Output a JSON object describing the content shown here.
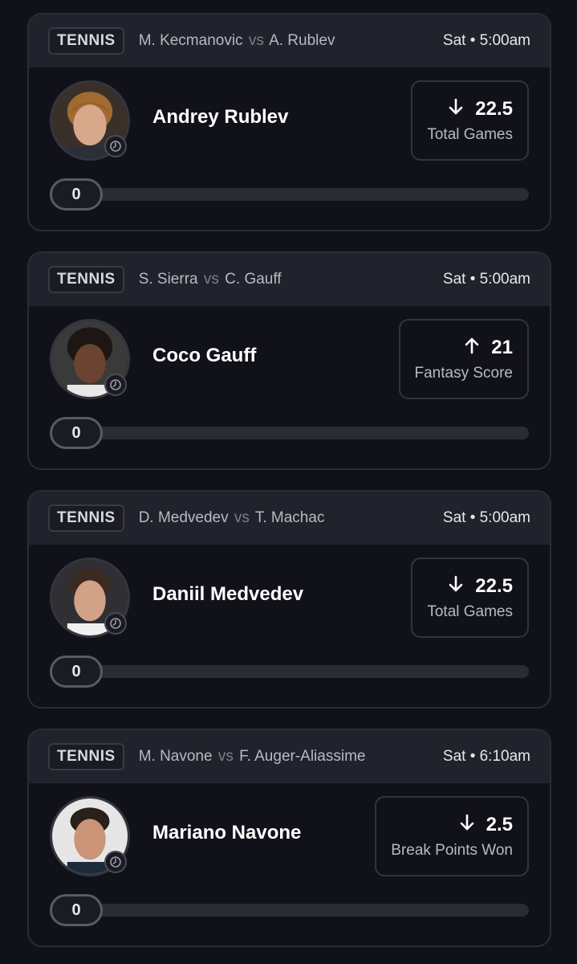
{
  "cards": [
    {
      "sport": "TENNIS",
      "home": "M. Kecmanovic",
      "vs": "vs",
      "away": "A. Rublev",
      "time": "Sat • 5:00am",
      "player": "Andrey Rublev",
      "direction": "down",
      "line": "22.5",
      "stat": "Total Games",
      "progress_value": "0",
      "progress_fraction": 0
    },
    {
      "sport": "TENNIS",
      "home": "S. Sierra",
      "vs": "vs",
      "away": "C. Gauff",
      "time": "Sat • 5:00am",
      "player": "Coco Gauff",
      "direction": "up",
      "line": "21",
      "stat": "Fantasy Score",
      "progress_value": "0",
      "progress_fraction": 0
    },
    {
      "sport": "TENNIS",
      "home": "D. Medvedev",
      "vs": "vs",
      "away": "T. Machac",
      "time": "Sat • 5:00am",
      "player": "Daniil Medvedev",
      "direction": "down",
      "line": "22.5",
      "stat": "Total Games",
      "progress_value": "0",
      "progress_fraction": 0
    },
    {
      "sport": "TENNIS",
      "home": "M. Navone",
      "vs": "vs",
      "away": "F. Auger-Aliassime",
      "time": "Sat • 6:10am",
      "player": "Mariano Navone",
      "direction": "down",
      "line": "2.5",
      "stat": "Break Points Won",
      "progress_value": "0",
      "progress_fraction": 0
    }
  ],
  "icons": {
    "arrow_down": "arrow-down-icon",
    "arrow_up": "arrow-up-icon",
    "clock": "clock-icon"
  },
  "colors": {
    "background": "#11111a",
    "header": "#22222c",
    "card_border": "#2c2c36",
    "text_primary": "#ffffff",
    "text_secondary": "#b9b9c4"
  }
}
